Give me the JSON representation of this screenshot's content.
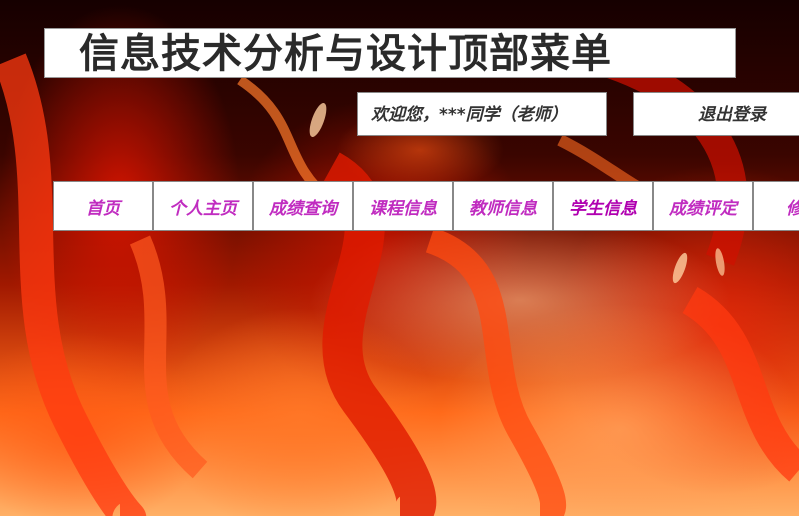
{
  "header": {
    "title": "信息技术分析与设计顶部菜单",
    "welcome": "欢迎您，***同学（老师）",
    "logout": "退出登录"
  },
  "nav": {
    "items": [
      {
        "label": "首页"
      },
      {
        "label": "个人主页"
      },
      {
        "label": "成绩查询"
      },
      {
        "label": "课程信息"
      },
      {
        "label": "教师信息"
      },
      {
        "label": "学生信息"
      },
      {
        "label": "成绩评定"
      },
      {
        "label": "修改"
      }
    ]
  },
  "colors": {
    "nav_text": "#c02cc0",
    "title_text": "#2a2a2a",
    "box_background": "#ffffff"
  }
}
